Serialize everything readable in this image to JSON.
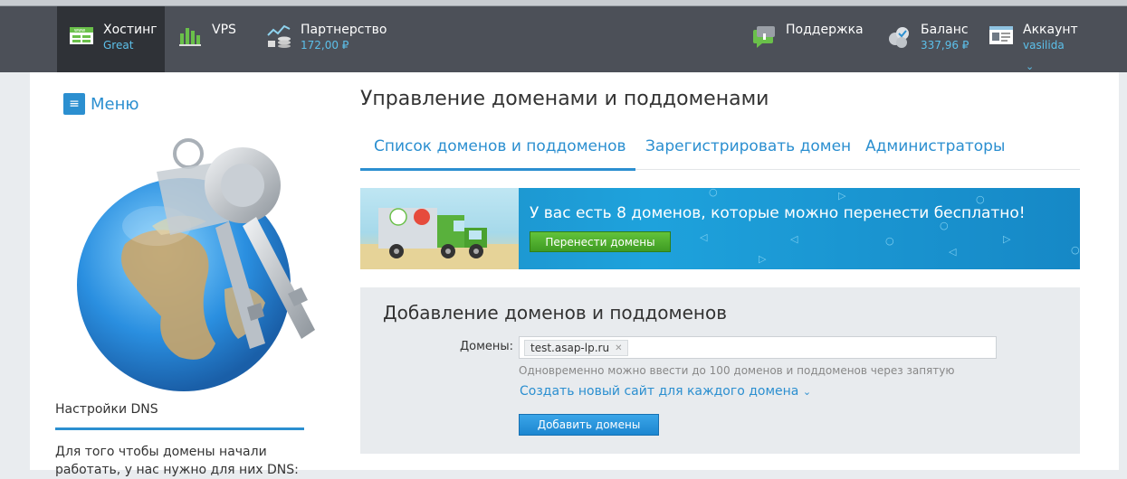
{
  "topbar": {
    "hosting": {
      "title": "Хостинг",
      "sub": "Great",
      "icon": "hosting-icon"
    },
    "vps": {
      "title": "VPS",
      "icon": "vps-icon"
    },
    "partner": {
      "title": "Партнерство",
      "sub": "172,00 ₽",
      "icon": "partner-icon"
    },
    "support": {
      "title": "Поддержка",
      "icon": "support-icon"
    },
    "balance": {
      "title": "Баланс",
      "sub": "337,96 ₽",
      "icon": "balance-icon"
    },
    "account": {
      "title": "Аккаунт",
      "sub": "vasilida",
      "icon": "account-icon"
    }
  },
  "sidebar": {
    "menu_label": "Меню",
    "dns_title": "Настройки DNS",
    "dns_text": "Для того чтобы домены начали работать, у нас нужно для них DNS:"
  },
  "main": {
    "title": "Управление доменами и поддоменами",
    "tabs": [
      {
        "label": "Список доменов и поддоменов",
        "active": true
      },
      {
        "label": "Зарегистрировать домен",
        "active": false
      },
      {
        "label": "Администраторы",
        "active": false
      }
    ],
    "banner": {
      "text": "У вас есть 8 доменов, которые можно перенести бесплатно!",
      "button": "Перенести домены"
    },
    "add_panel": {
      "title": "Добавление доменов и поддоменов",
      "domains_label": "Домены:",
      "token": "test.asap-lp.ru",
      "hint": "Одновременно можно ввести до 100 доменов и поддоменов через запятую",
      "create_link": "Создать новый сайт для каждого домена",
      "submit": "Добавить домены"
    }
  },
  "colors": {
    "accent": "#2b8fd0",
    "topbar": "#4c5058",
    "green": "#4aa92a"
  }
}
